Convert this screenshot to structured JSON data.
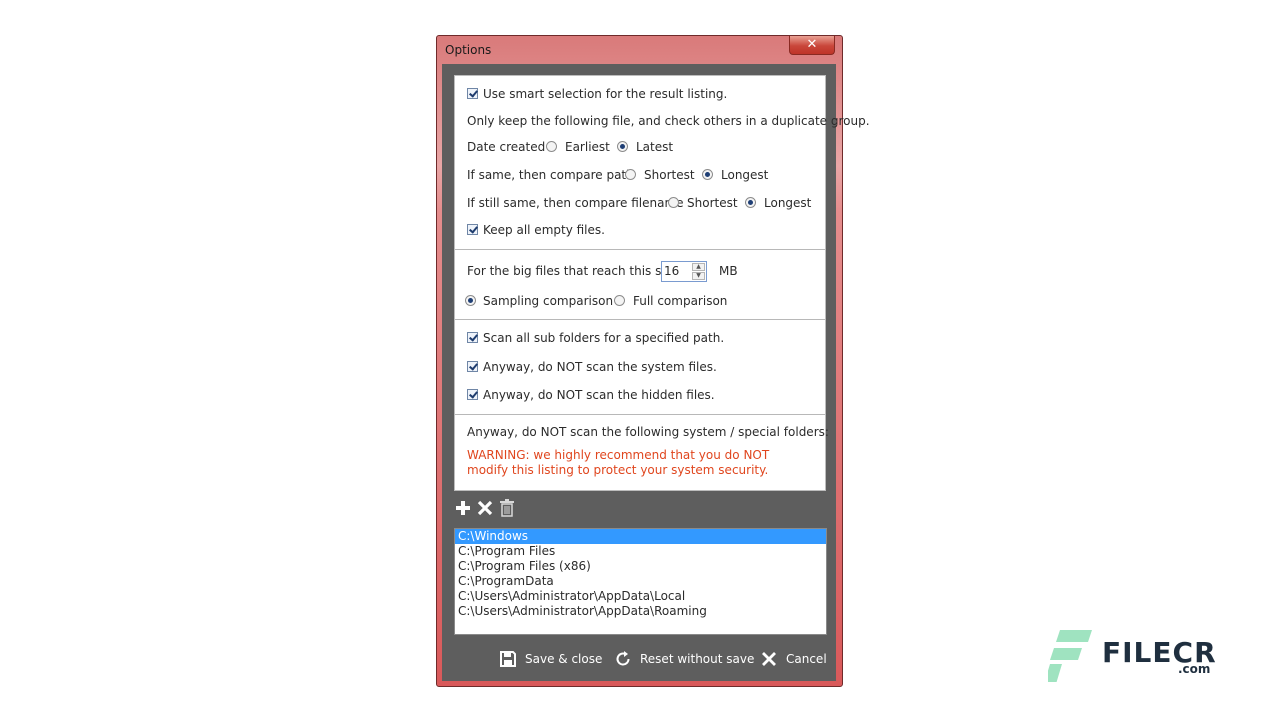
{
  "window": {
    "title": "Options",
    "close_label": "✕"
  },
  "options": {
    "smart_selection": {
      "label": "Use smart selection for the result listing.",
      "checked": true
    },
    "keep_intro": "Only keep the following file, and check others in a duplicate group.",
    "date_created": {
      "label": "Date created",
      "opt1": "Earliest",
      "opt2": "Latest",
      "selected": "Latest"
    },
    "compare_path": {
      "label": "If same, then compare path",
      "opt1": "Shortest",
      "opt2": "Longest",
      "selected": "Longest"
    },
    "compare_filename": {
      "label": "If still same, then compare filename",
      "opt1": "Shortest",
      "opt2": "Longest",
      "selected": "Longest"
    },
    "keep_empty": {
      "label": "Keep all empty files.",
      "checked": true
    },
    "big_files": {
      "label": "For the big files that reach this size",
      "value": "16",
      "unit": "MB"
    },
    "comparison": {
      "opt1": "Sampling comparison",
      "opt2": "Full comparison",
      "selected": "Sampling comparison"
    },
    "scan_subfolders": {
      "label": "Scan all sub folders for a specified path.",
      "checked": true
    },
    "skip_system": {
      "label": "Anyway, do NOT scan the system files.",
      "checked": true
    },
    "skip_hidden": {
      "label": "Anyway, do NOT scan the hidden files.",
      "checked": true
    },
    "special_folders_label": "Anyway, do NOT scan the following system / special folders:",
    "warning": "WARNING: we highly recommend that you do NOT modify this listing to protect your system security."
  },
  "toolbar": {
    "add_icon": "plus-icon",
    "remove_icon": "x-icon",
    "clear_icon": "trash-icon"
  },
  "folders": [
    "C:\\Windows",
    "C:\\Program Files",
    "C:\\Program Files (x86)",
    "C:\\ProgramData",
    "C:\\Users\\Administrator\\AppData\\Local",
    "C:\\Users\\Administrator\\AppData\\Roaming"
  ],
  "buttons": {
    "save": "Save & close",
    "reset": "Reset without save",
    "cancel": "Cancel"
  },
  "watermark": {
    "name": "FILECR",
    "suffix": ".com"
  },
  "colors": {
    "warning": "#e0461e",
    "selection": "#3399ff",
    "dialog_bg": "#5e5e5e",
    "frame": "#d9595a"
  }
}
